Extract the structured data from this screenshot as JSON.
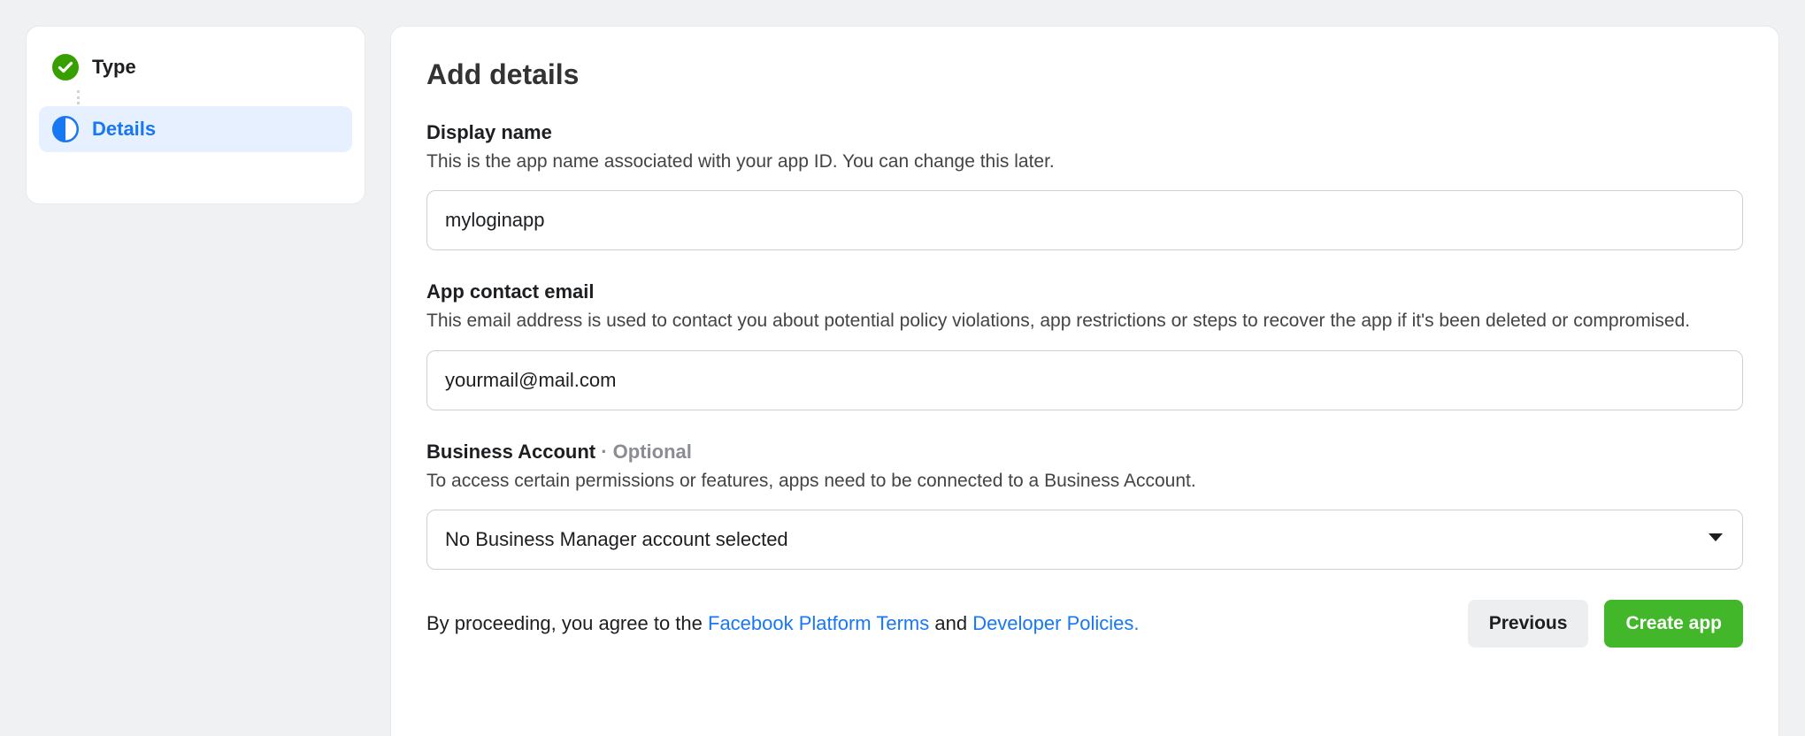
{
  "sidebar": {
    "steps": [
      {
        "label": "Type",
        "state": "done"
      },
      {
        "label": "Details",
        "state": "active"
      }
    ]
  },
  "main": {
    "title": "Add details",
    "display_name": {
      "label": "Display name",
      "help": "This is the app name associated with your app ID. You can change this later.",
      "value": "myloginapp"
    },
    "contact_email": {
      "label": "App contact email",
      "help": "This email address is used to contact you about potential policy violations, app restrictions or steps to recover the app if it's been deleted or compromised.",
      "value": "yourmail@mail.com"
    },
    "business_account": {
      "label": "Business Account",
      "optional_tag": " · Optional",
      "help": "To access certain permissions or features, apps need to be connected to a Business Account.",
      "selected": "No Business Manager account selected"
    },
    "agreement": {
      "pre": "By proceeding, you agree to the ",
      "link1": "Facebook Platform Terms",
      "mid": " and ",
      "link2": "Developer Policies."
    },
    "buttons": {
      "previous": "Previous",
      "create": "Create app"
    }
  },
  "colors": {
    "accent_blue": "#1877f2",
    "accent_green": "#42b72a",
    "check_green": "#37a000"
  }
}
